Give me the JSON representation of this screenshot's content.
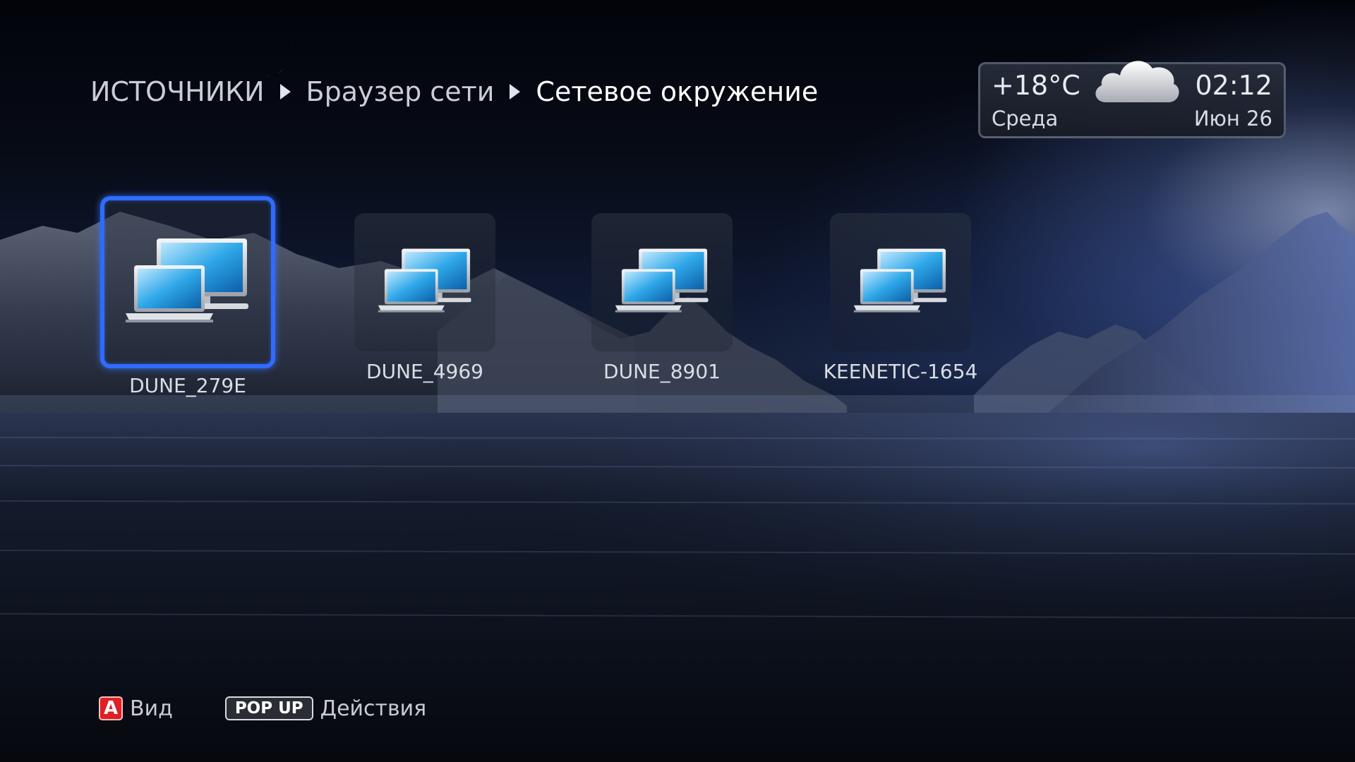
{
  "breadcrumb": {
    "root": "ИСТОЧНИКИ",
    "level1": "Браузер сети",
    "current": "Сетевое окружение"
  },
  "weather": {
    "temperature": "+18°C",
    "time": "02:12",
    "day": "Среда",
    "date": "Июн 26",
    "icon": "cloud-icon"
  },
  "items": [
    {
      "label": "DUNE_279E",
      "icon": "network-computers-icon",
      "selected": true
    },
    {
      "label": "DUNE_4969",
      "icon": "network-computers-icon",
      "selected": false
    },
    {
      "label": "DUNE_8901",
      "icon": "network-computers-icon",
      "selected": false
    },
    {
      "label": "KEENETIC-1654",
      "icon": "network-computers-icon",
      "selected": false
    }
  ],
  "footer": {
    "key_a": "A",
    "key_a_action": "Вид",
    "key_popup": "POP UP",
    "key_popup_action": "Действия"
  },
  "colors": {
    "selection": "#2f6bff",
    "key_a": "#e01e24"
  }
}
